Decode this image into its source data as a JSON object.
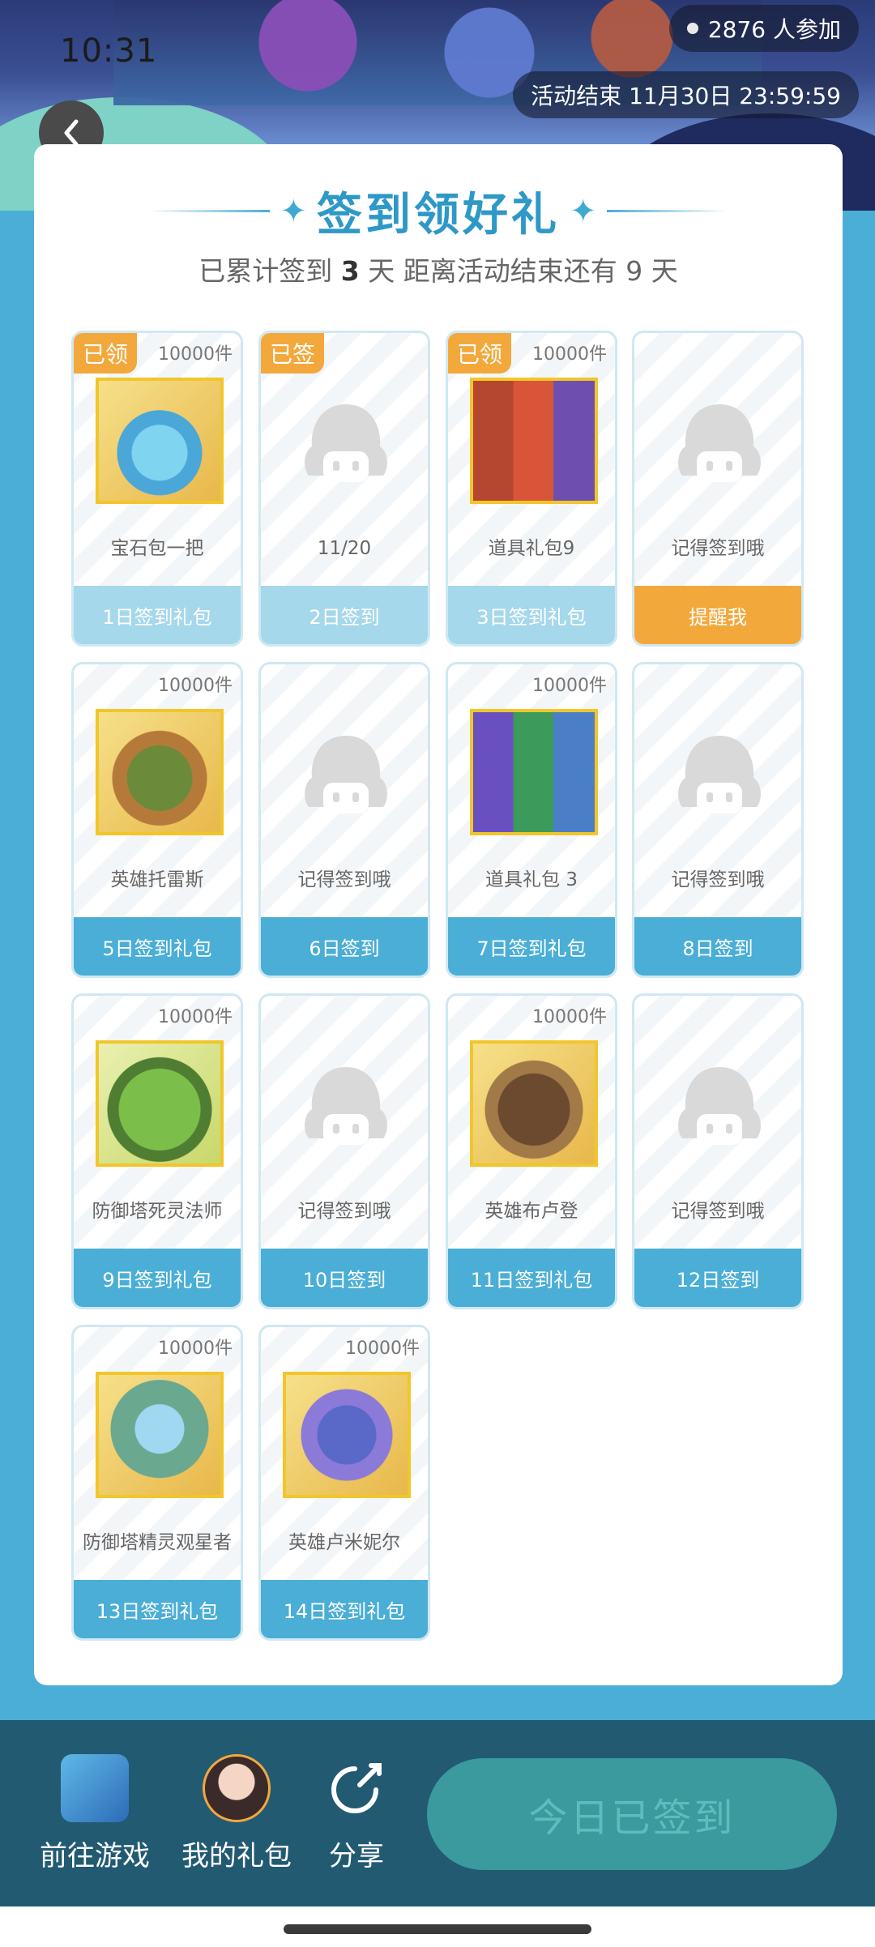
{
  "status": {
    "time": "10:31"
  },
  "banner": {
    "participants": "2876 人参加",
    "end_time": "活动结束 11月30日 23:59:59"
  },
  "header": {
    "title": "签到领好礼",
    "subtitle_prefix": "已累计签到",
    "signed_days": "3",
    "subtitle_mid": "天  距离活动结束还有",
    "remaining_days": "9",
    "subtitle_suffix": "天"
  },
  "days": [
    {
      "tag": "已领",
      "count": "10000件",
      "image": "gem-pile",
      "name": "宝石包一把",
      "footer": "1日签到礼包",
      "style": "light"
    },
    {
      "tag": "已签",
      "count": "",
      "image": "placeholder",
      "name": "11/20",
      "footer": "2日签到",
      "style": "light"
    },
    {
      "tag": "已领",
      "count": "10000件",
      "image": "cards-red",
      "name": "道具礼包9",
      "footer": "3日签到礼包",
      "style": "light"
    },
    {
      "tag": "",
      "count": "",
      "image": "placeholder",
      "name": "记得签到哦",
      "footer": "提醒我",
      "style": "orange"
    },
    {
      "tag": "",
      "count": "10000件",
      "image": "hero-torres",
      "name": "英雄托雷斯",
      "footer": "5日签到礼包",
      "style": "blue"
    },
    {
      "tag": "",
      "count": "",
      "image": "placeholder",
      "name": "记得签到哦",
      "footer": "6日签到",
      "style": "blue"
    },
    {
      "tag": "",
      "count": "10000件",
      "image": "cards-purple",
      "name": "道具礼包 3",
      "footer": "7日签到礼包",
      "style": "blue"
    },
    {
      "tag": "",
      "count": "",
      "image": "placeholder",
      "name": "记得签到哦",
      "footer": "8日签到",
      "style": "blue"
    },
    {
      "tag": "",
      "count": "10000件",
      "image": "tower-necromancer",
      "name": "防御塔死灵法师",
      "footer": "9日签到礼包",
      "style": "blue"
    },
    {
      "tag": "",
      "count": "",
      "image": "placeholder",
      "name": "记得签到哦",
      "footer": "10日签到",
      "style": "blue"
    },
    {
      "tag": "",
      "count": "10000件",
      "image": "hero-griffin",
      "name": "英雄布卢登",
      "footer": "11日签到礼包",
      "style": "blue"
    },
    {
      "tag": "",
      "count": "",
      "image": "placeholder",
      "name": "记得签到哦",
      "footer": "12日签到",
      "style": "blue"
    },
    {
      "tag": "",
      "count": "10000件",
      "image": "tower-elven",
      "name": "防御塔精灵观星者",
      "footer": "13日签到礼包",
      "style": "blue"
    },
    {
      "tag": "",
      "count": "10000件",
      "image": "hero-dragon",
      "name": "英雄卢米妮尔",
      "footer": "14日签到礼包",
      "style": "blue"
    }
  ],
  "bottom_bar": {
    "go_game": "前往游戏",
    "my_gifts": "我的礼包",
    "share": "分享",
    "checkin_button": "今日已签到"
  },
  "colors": {
    "accent": "#4aaed6",
    "tag": "#f3a83c",
    "bottom_bar": "#225a72",
    "checkin_disabled": "#3b9a9d"
  }
}
